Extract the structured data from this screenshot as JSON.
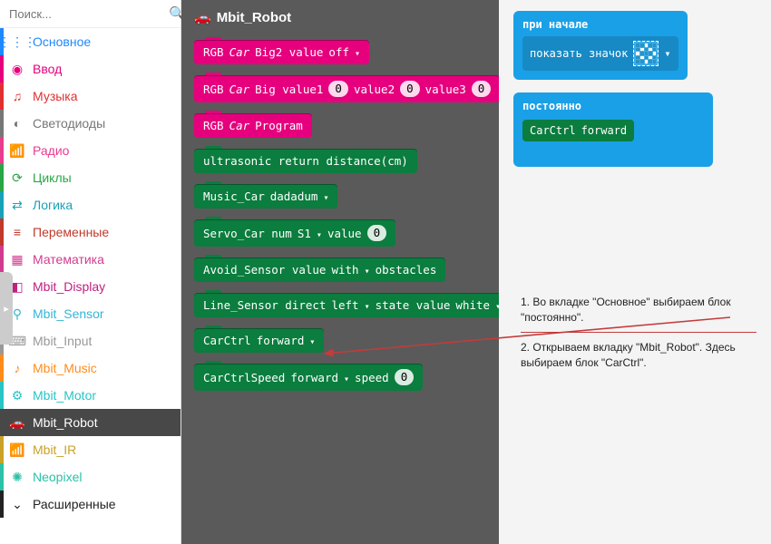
{
  "search": {
    "placeholder": "Поиск..."
  },
  "sidebar": [
    {
      "id": "basic",
      "label": "Основное",
      "cls": "c-blue",
      "icon": "⋮⋮⋮"
    },
    {
      "id": "input",
      "label": "Ввод",
      "cls": "c-pink",
      "icon": "◉"
    },
    {
      "id": "music",
      "label": "Музыка",
      "cls": "c-red",
      "icon": "♫"
    },
    {
      "id": "leds",
      "label": "Светодиоды",
      "cls": "c-gray",
      "icon": "◐"
    },
    {
      "id": "radio",
      "label": "Радио",
      "cls": "c-rose",
      "icon": "📶"
    },
    {
      "id": "loops",
      "label": "Циклы",
      "cls": "c-green",
      "icon": "⟳"
    },
    {
      "id": "logic",
      "label": "Логика",
      "cls": "c-teal",
      "icon": "⇄"
    },
    {
      "id": "vars",
      "label": "Переменные",
      "cls": "c-maroon",
      "icon": "≡"
    },
    {
      "id": "math",
      "label": "Математика",
      "cls": "c-purple",
      "icon": "▦"
    },
    {
      "id": "mdisp",
      "label": "Mbit_Display",
      "cls": "c-mag",
      "icon": "◧"
    },
    {
      "id": "msens",
      "label": "Mbit_Sensor",
      "cls": "c-sky",
      "icon": "⚲"
    },
    {
      "id": "minput",
      "label": "Mbit_Input",
      "cls": "c-silver",
      "icon": "⌨"
    },
    {
      "id": "mmusic",
      "label": "Mbit_Music",
      "cls": "c-orange",
      "icon": "♪"
    },
    {
      "id": "mmotor",
      "label": "Mbit_Motor",
      "cls": "c-cyan",
      "icon": "⚙"
    },
    {
      "id": "mrobot",
      "label": "Mbit_Robot",
      "cls": "c-robot sel",
      "icon": "🚗"
    },
    {
      "id": "mir",
      "label": "Mbit_IR",
      "cls": "c-wifi",
      "icon": "📶"
    },
    {
      "id": "neopix",
      "label": "Neopixel",
      "cls": "c-neo",
      "icon": "✺"
    },
    {
      "id": "adv",
      "label": "Расширенные",
      "cls": "c-adv",
      "icon": "⌄"
    }
  ],
  "palette": {
    "title": "Mbit_Robot",
    "title_icon": "🚗",
    "blocks": {
      "b1": {
        "pre": "RGB",
        "em": "Car",
        "post": "Big2 value",
        "dd": "off"
      },
      "b2": {
        "pre": "RGB",
        "em": "Car",
        "t1": "Big value1",
        "v1": "0",
        "t2": "value2",
        "v2": "0",
        "t3": "value3",
        "v3": "0"
      },
      "b3": {
        "pre": "RGB",
        "em": "Car",
        "post": "Program"
      },
      "b4": {
        "text": "ultrasonic return distance(cm)"
      },
      "b5": {
        "t": "Music_Car",
        "dd": "dadadum"
      },
      "b6": {
        "t1": "Servo_Car num",
        "dd": "S1",
        "t2": "value",
        "v": "0"
      },
      "b7": {
        "t1": "Avoid_Sensor value",
        "dd": "with",
        "t2": "obstacles"
      },
      "b8": {
        "t1": "Line_Sensor direct",
        "dd1": "left",
        "t2": "state value",
        "dd2": "white"
      },
      "b9": {
        "t": "CarCtrl",
        "dd": "forward"
      },
      "b10": {
        "t": "CarCtrlSpeed",
        "dd": "forward",
        "t2": "speed",
        "v": "0"
      }
    }
  },
  "canvas": {
    "hat1": {
      "title": "при начале",
      "inner": "показать значок"
    },
    "hat2": {
      "title": "постоянно",
      "block": {
        "t": "CarCtrl",
        "dd": "forward"
      }
    }
  },
  "instructions": {
    "p1": "1. Во вкладке \"Основное\" выбираем блок \"постоянно\".",
    "p2": "2. Открываем вкладку \"Mbit_Robot\". Здесь выбираем блок \"CarCtrl\"."
  }
}
